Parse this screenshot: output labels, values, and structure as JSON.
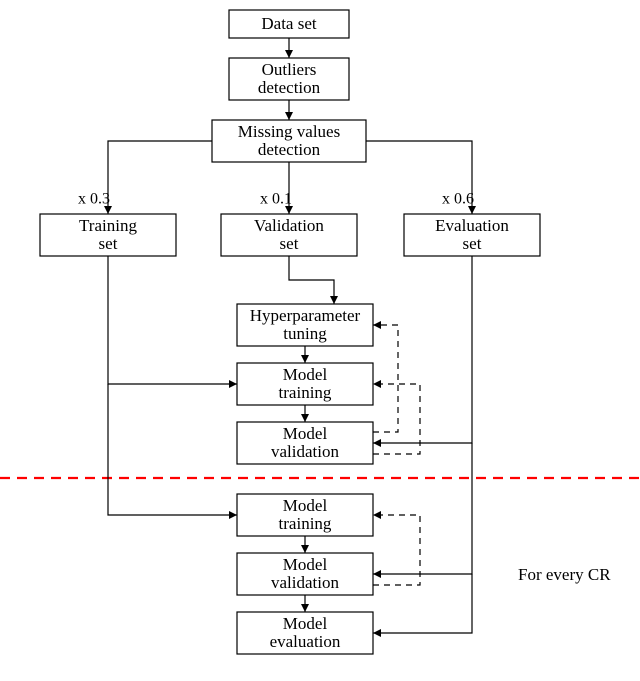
{
  "chart_data": {
    "type": "flowchart",
    "nodes": [
      {
        "id": "dataset",
        "label": "Data set"
      },
      {
        "id": "outliers",
        "label": "Outliers detection"
      },
      {
        "id": "missing",
        "label": "Missing values detection"
      },
      {
        "id": "train",
        "label": "Training set",
        "ratio": "x 0.3"
      },
      {
        "id": "valid",
        "label": "Validation set",
        "ratio": "x 0.1"
      },
      {
        "id": "eval",
        "label": "Evaluation set",
        "ratio": "x 0.6"
      },
      {
        "id": "hyper",
        "label": "Hyperparameter tuning"
      },
      {
        "id": "mtrain1",
        "label": "Model training"
      },
      {
        "id": "mvalid1",
        "label": "Model validation"
      },
      {
        "id": "mtrain2",
        "label": "Model training"
      },
      {
        "id": "mvalid2",
        "label": "Model validation"
      },
      {
        "id": "meval",
        "label": "Model evaluation"
      }
    ],
    "edges": [
      {
        "from": "dataset",
        "to": "outliers",
        "style": "solid"
      },
      {
        "from": "outliers",
        "to": "missing",
        "style": "solid"
      },
      {
        "from": "missing",
        "to": "train",
        "style": "solid"
      },
      {
        "from": "missing",
        "to": "valid",
        "style": "solid"
      },
      {
        "from": "missing",
        "to": "eval",
        "style": "solid"
      },
      {
        "from": "valid",
        "to": "hyper",
        "style": "solid"
      },
      {
        "from": "hyper",
        "to": "mtrain1",
        "style": "solid"
      },
      {
        "from": "mtrain1",
        "to": "mvalid1",
        "style": "solid"
      },
      {
        "from": "train",
        "to": "mtrain1",
        "style": "solid"
      },
      {
        "from": "train",
        "to": "mtrain2",
        "style": "solid"
      },
      {
        "from": "eval",
        "to": "mvalid1",
        "style": "solid"
      },
      {
        "from": "eval",
        "to": "mvalid2",
        "style": "solid"
      },
      {
        "from": "eval",
        "to": "meval",
        "style": "solid"
      },
      {
        "from": "mtrain2",
        "to": "mvalid2",
        "style": "solid"
      },
      {
        "from": "mvalid2",
        "to": "meval",
        "style": "solid"
      },
      {
        "from": "mvalid1",
        "to": "hyper",
        "style": "dashed"
      },
      {
        "from": "mvalid1",
        "to": "mtrain1",
        "style": "dashed"
      },
      {
        "from": "mvalid2",
        "to": "mtrain2",
        "style": "dashed"
      }
    ],
    "separator": "horizontal dashed red line between the two Model-training/validation cycles",
    "annotation": "For every CR"
  },
  "labels": {
    "dataset": "Data set",
    "outliers1": "Outliers",
    "outliers2": "detection",
    "missing1": "Missing values",
    "missing2": "detection",
    "train1": "Training",
    "train2": "set",
    "valid1": "Validation",
    "valid2": "set",
    "eval1": "Evaluation",
    "eval2": "set",
    "ratio_train": "x 0.3",
    "ratio_valid": "x 0.1",
    "ratio_eval": "x 0.6",
    "hyper1": "Hyperparameter",
    "hyper2": "tuning",
    "mtrain1a": "Model",
    "mtrain1b": "training",
    "mvalid1a": "Model",
    "mvalid1b": "validation",
    "mtrain2a": "Model",
    "mtrain2b": "training",
    "mvalid2a": "Model",
    "mvalid2b": "validation",
    "meval1": "Model",
    "meval2": "evaluation",
    "note": "For every CR"
  }
}
